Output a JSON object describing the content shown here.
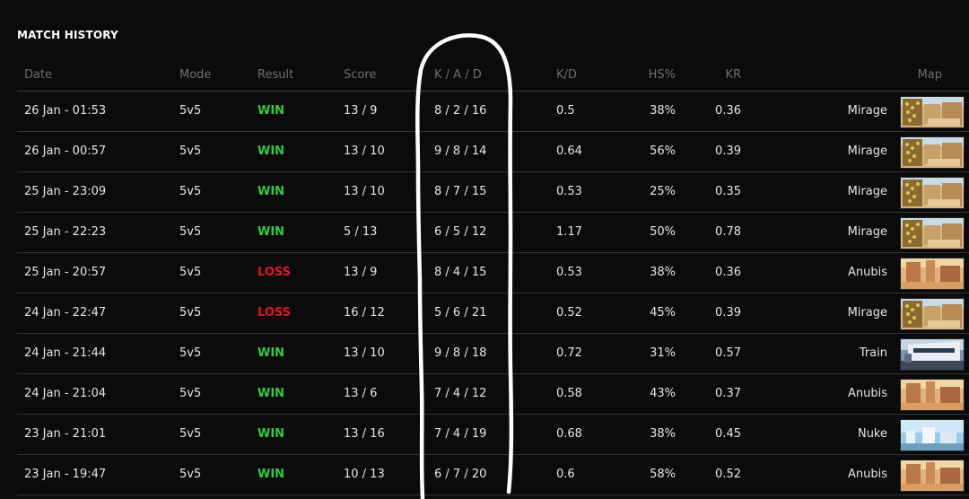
{
  "page": {
    "title": "MATCH HISTORY"
  },
  "columns": {
    "date": "Date",
    "mode": "Mode",
    "result": "Result",
    "score": "Score",
    "kad": "K / A / D",
    "kd": "K/D",
    "hs": "HS%",
    "kr": "KR",
    "map": "Map"
  },
  "rows": [
    {
      "date": "26 Jan - 01:53",
      "mode": "5v5",
      "result": "WIN",
      "score": "13 / 9",
      "kad": "8 / 2 / 16",
      "kd": "0.5",
      "hs": "38%",
      "kr": "0.36",
      "map": "Mirage"
    },
    {
      "date": "26 Jan - 00:57",
      "mode": "5v5",
      "result": "WIN",
      "score": "13 / 10",
      "kad": "9 / 8 / 14",
      "kd": "0.64",
      "hs": "56%",
      "kr": "0.39",
      "map": "Mirage"
    },
    {
      "date": "25 Jan - 23:09",
      "mode": "5v5",
      "result": "WIN",
      "score": "13 / 10",
      "kad": "8 / 7 / 15",
      "kd": "0.53",
      "hs": "25%",
      "kr": "0.35",
      "map": "Mirage"
    },
    {
      "date": "25 Jan - 22:23",
      "mode": "5v5",
      "result": "WIN",
      "score": "5 / 13",
      "kad": "6 / 5 / 12",
      "kd": "1.17",
      "hs": "50%",
      "kr": "0.78",
      "map": "Mirage"
    },
    {
      "date": "25 Jan - 20:57",
      "mode": "5v5",
      "result": "LOSS",
      "score": "13 / 9",
      "kad": "8 / 4 / 15",
      "kd": "0.53",
      "hs": "38%",
      "kr": "0.36",
      "map": "Anubis"
    },
    {
      "date": "24 Jan - 22:47",
      "mode": "5v5",
      "result": "LOSS",
      "score": "16 / 12",
      "kad": "5 / 6 / 21",
      "kd": "0.52",
      "hs": "45%",
      "kr": "0.39",
      "map": "Mirage"
    },
    {
      "date": "24 Jan - 21:44",
      "mode": "5v5",
      "result": "WIN",
      "score": "13 / 10",
      "kad": "9 / 8 / 18",
      "kd": "0.72",
      "hs": "31%",
      "kr": "0.57",
      "map": "Train"
    },
    {
      "date": "24 Jan - 21:04",
      "mode": "5v5",
      "result": "WIN",
      "score": "13 / 6",
      "kad": "7 / 4 / 12",
      "kd": "0.58",
      "hs": "43%",
      "kr": "0.37",
      "map": "Anubis"
    },
    {
      "date": "23 Jan - 21:01",
      "mode": "5v5",
      "result": "WIN",
      "score": "13 / 16",
      "kad": "7 / 4 / 19",
      "kd": "0.68",
      "hs": "38%",
      "kr": "0.45",
      "map": "Nuke"
    },
    {
      "date": "23 Jan - 19:47",
      "mode": "5v5",
      "result": "WIN",
      "score": "10 / 13",
      "kad": "6 / 7 / 20",
      "kd": "0.6",
      "hs": "58%",
      "kr": "0.52",
      "map": "Anubis"
    }
  ],
  "colors": {
    "win": "#2ecc40",
    "loss": "#e3162b",
    "background": "#0b0b0b",
    "annotation": "#ffffff"
  },
  "annotation": {
    "shape": "hand-drawn-loop",
    "target_column": "kad"
  }
}
